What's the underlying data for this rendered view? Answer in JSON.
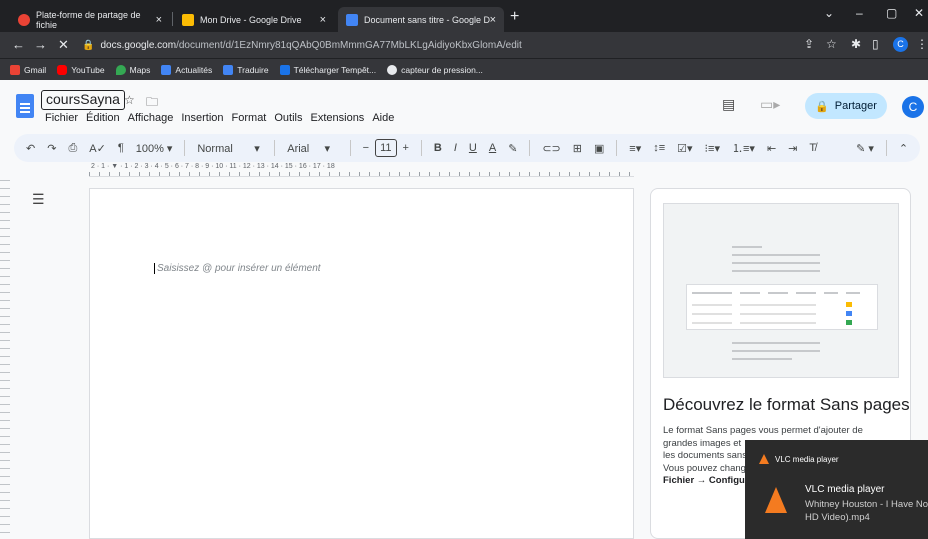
{
  "browser": {
    "tabs": [
      {
        "label": "Plate-forme de partage de fichie",
        "color": "#ea4335"
      },
      {
        "label": "Mon Drive - Google Drive",
        "color": "#fbbc04"
      },
      {
        "label": "Document sans titre - Google Do",
        "color": "#4285f4"
      }
    ],
    "window_controls": {
      "chevron": "⌄",
      "minimize": "–",
      "maximize": "▢",
      "close": "✕"
    },
    "url_host": "docs.google.com",
    "url_path": "/document/d/1EzNmry81qQAbQ0BmMmmGA77MbLKLgAidiyoKbxGlomA/edit",
    "profile_initial": "C",
    "bookmarks": [
      {
        "label": "Gmail",
        "color": "#ea4335"
      },
      {
        "label": "YouTube",
        "color": "#ff0000"
      },
      {
        "label": "Maps",
        "color": "#34a853"
      },
      {
        "label": "Actualités",
        "color": "#4285f4"
      },
      {
        "label": "Traduire",
        "color": "#4285f4"
      },
      {
        "label": "Télécharger Tempêt...",
        "color": "#1a73e8"
      },
      {
        "label": "capteur de pression...",
        "color": "#e8eaed"
      }
    ]
  },
  "docs": {
    "title": "coursSayna",
    "menu": [
      "Fichier",
      "Édition",
      "Affichage",
      "Insertion",
      "Format",
      "Outils",
      "Extensions",
      "Aide"
    ],
    "share_label": "Partager",
    "user_initial": "C",
    "toolbar": {
      "zoom": "100%",
      "style": "Normal",
      "font": "Arial",
      "font_size": "11"
    },
    "ruler_labels": "2 · 1 · ▼ · 1 · 2 · 3 · 4 · 5 · 6 · 7 · 8 · 9 · 10 · 11 · 12 · 13 · 14 · 15 · 16 · 17 · 18",
    "placeholder": "Saisissez @ pour insérer un élément"
  },
  "side_panel": {
    "title": "Découvrez le format Sans pages",
    "text_lines": [
      "Le format Sans pages vous permet d'ajouter de",
      "grandes images et",
      "les documents sans",
      "Vous pouvez chang"
    ],
    "menu_path": "Fichier → Configu"
  },
  "vlc": {
    "app": "VLC media player",
    "title": "VLC media player",
    "song_line1": "Whitney Houston - I Have No",
    "song_line2": "HD Video).mp4",
    "accent": "#f47b20"
  }
}
